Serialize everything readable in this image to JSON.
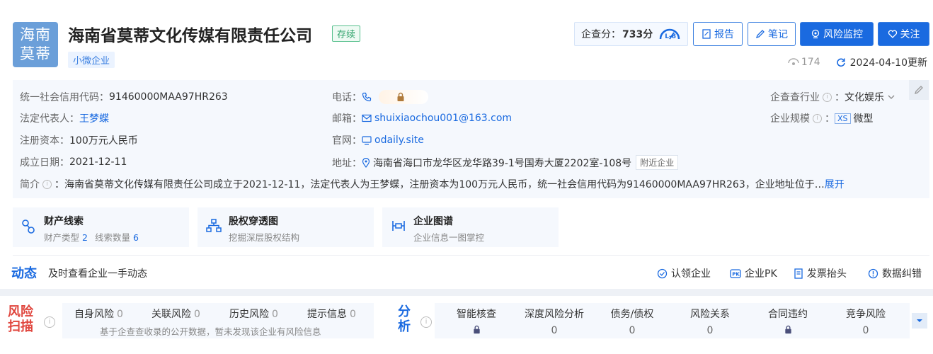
{
  "company": {
    "logo_line1": "海南",
    "logo_line2": "莫蒂",
    "name": "海南省莫蒂文化传媒有限责任公司",
    "status": "存续",
    "tag": "小微企业"
  },
  "score": {
    "label": "企查分：",
    "value": "733分",
    "level": "L-8"
  },
  "buttons": {
    "report": "报告",
    "notes": "笔记",
    "monitor": "风险监控",
    "follow": "关注"
  },
  "meta": {
    "views": "174",
    "updated": "2024-04-10更新"
  },
  "info": {
    "credit_code_label": "统一社会信用代码：",
    "credit_code": "91460000MAA97HR263",
    "legal_rep_label": "法定代表人：",
    "legal_rep": "王梦蝶",
    "capital_label": "注册资本：",
    "capital": "100万元人民币",
    "founded_label": "成立日期：",
    "founded": "2021-12-11",
    "phone_label": "电话：",
    "email_label": "邮箱：",
    "email": "shuixiaochou001@163.com",
    "website_label": "官网：",
    "website": "odaily.site",
    "address_label": "地址：",
    "address": "海南省海口市龙华区龙华路39-1号国寿大厦2202室-108号",
    "nearby": "附近企业",
    "industry_label": "企查查行业",
    "industry": "文化娱乐",
    "scale_label": "企业规模",
    "scale_badge": "XS",
    "scale": "微型",
    "intro_label": "简介",
    "intro": "：海南省莫蒂文化传媒有限责任公司成立于2021-12-11，法定代表人为王梦蝶，注册资本为100万元人民币，统一社会信用代码为91460000MAA97HR263，企业地址位于…",
    "expand": "展开"
  },
  "tiles": [
    {
      "title": "财产线索",
      "sub_a": "财产类型",
      "num_a": "2",
      "sub_b": "线索数量",
      "num_b": "6"
    },
    {
      "title": "股权穿透图",
      "sub": "挖掘深层股权结构"
    },
    {
      "title": "企业图谱",
      "sub": "企业信息一图掌控"
    }
  ],
  "dynamics": {
    "title": "动态",
    "subtitle": "及时查看企业一手动态",
    "actions": [
      "认领企业",
      "企业PK",
      "发票抬头",
      "数据纠错"
    ]
  },
  "risk": {
    "logo_line1": "风险",
    "logo_line2": "扫描",
    "items": [
      {
        "label": "自身风险",
        "count": "0"
      },
      {
        "label": "关联风险",
        "count": "0"
      },
      {
        "label": "历史风险",
        "count": "0"
      },
      {
        "label": "提示信息",
        "count": "0"
      }
    ],
    "note": "基于企查查收录的公开数据，暂未发现该企业有风险信息"
  },
  "analysis": {
    "logo_line1": "分",
    "logo_line2": "析",
    "items": [
      {
        "label": "智能核查",
        "value": ""
      },
      {
        "label": "深度风险分析",
        "value": "0"
      },
      {
        "label": "债务/债权",
        "value": "0"
      },
      {
        "label": "风险关系",
        "value": "0"
      },
      {
        "label": "合同违约",
        "value": ""
      },
      {
        "label": "竞争风险",
        "value": "0"
      }
    ]
  }
}
